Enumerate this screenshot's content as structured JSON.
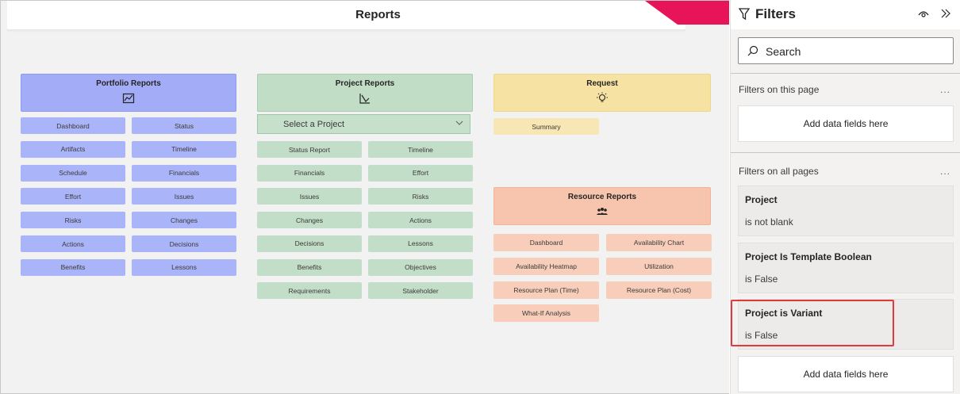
{
  "report": {
    "title": "Reports",
    "accent_color": "#e8145a"
  },
  "portfolio": {
    "title": "Portfolio Reports",
    "icon": "line-chart-icon",
    "color": "#a3adf7",
    "buttons": [
      "Dashboard",
      "Status",
      "Artifacts",
      "Timeline",
      "Schedule",
      "Financials",
      "Effort",
      "Issues",
      "Risks",
      "Changes",
      "Actions",
      "Decisions",
      "Benefits",
      "Lessons"
    ]
  },
  "project": {
    "title": "Project Reports",
    "icon": "trend-chart-icon",
    "color": "#c1ddc6",
    "select_value": "Select a Project",
    "buttons": [
      "Status Report",
      "Timeline",
      "Financials",
      "Effort",
      "Issues",
      "Risks",
      "Changes",
      "Actions",
      "Decisions",
      "Lessons",
      "Benefits",
      "Objectives",
      "Requirements",
      "Stakeholder"
    ]
  },
  "request": {
    "title": "Request",
    "icon": "lightbulb-icon",
    "color": "#f6e3a3",
    "buttons": [
      "Summary"
    ]
  },
  "resource": {
    "title": "Resource Reports",
    "icon": "people-icon",
    "color": "#f7c5ae",
    "buttons": [
      "Dashboard",
      "Availability Chart",
      "Availability Heatmap",
      "Utilization",
      "Resource Plan (Time)",
      "Resource Plan (Cost)",
      "What-If Analysis"
    ]
  },
  "filters": {
    "title": "Filters",
    "search_placeholder": "Search",
    "page_section": "Filters on this page",
    "all_section": "Filters on all pages",
    "more": "...",
    "drop_label": "Add data fields here",
    "cards": [
      {
        "name": "Project",
        "value": "is not blank"
      },
      {
        "name": "Project Is Template Boolean",
        "value": "is False"
      },
      {
        "name": "Project is Variant",
        "value": "is False"
      }
    ]
  }
}
